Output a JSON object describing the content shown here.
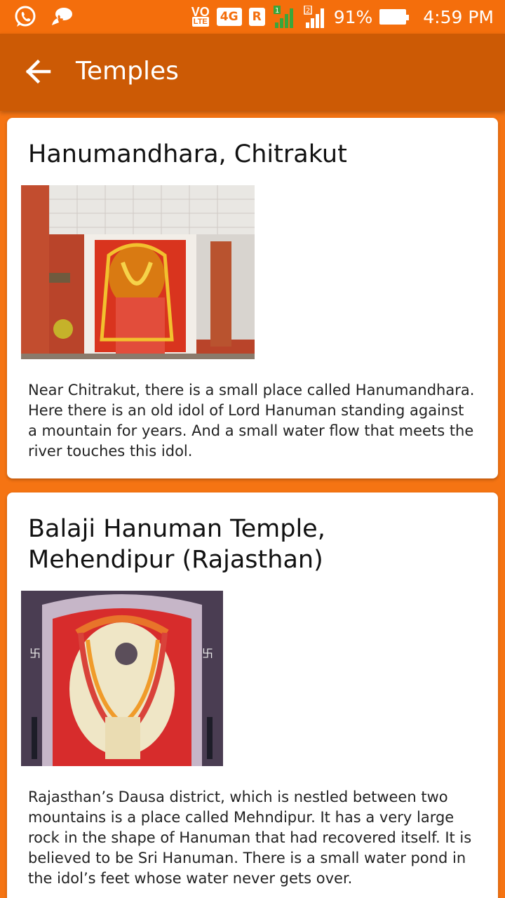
{
  "status_bar": {
    "volte_top": "VO",
    "volte_bottom": "LTE",
    "network": "4G",
    "roaming": "R",
    "sim1": "1",
    "sim2": "2",
    "battery": "91%",
    "time": "4:59 PM",
    "icons": [
      "whatsapp-icon",
      "chat-icon",
      "signal-icon",
      "battery-icon"
    ]
  },
  "app_bar": {
    "title": "Temples",
    "back_icon": "arrow-left-icon",
    "color": "#cc5a05"
  },
  "colors": {
    "background": "#f57413",
    "status_bar": "#f46e0c",
    "card": "#ffffff"
  },
  "temples": [
    {
      "title": "Hanumandhara, Chitrakut",
      "description": "Near Chitrakut, there is a small place called Hanumandhara. Here there is an old idol of Lord Hanuman standing against a mountain for years. And a small water flow that meets the river touches this idol."
    },
    {
      "title": "Balaji Hanuman Temple, Mehendipur (Rajasthan)",
      "description": "Rajasthan’s Dausa district, which is nestled between two mountains is a place called Mehndipur. It has a very large rock in the shape of Hanuman that had recovered itself. It is believed to be Sri Hanuman. There is a small water pond in the idol’s feet whose water never gets over."
    }
  ]
}
